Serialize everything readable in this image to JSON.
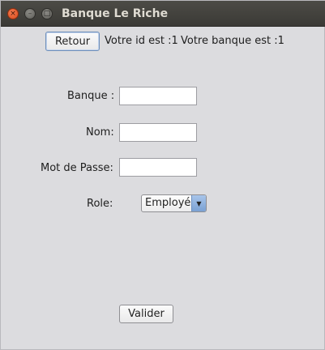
{
  "window": {
    "title": "Banque Le Riche",
    "controls": {
      "close_glyph": "×",
      "minimize_glyph": "–",
      "maximize_glyph": "□"
    }
  },
  "header": {
    "back_label": "Retour",
    "id_text": "Votre id est :1",
    "bank_text": "Votre banque est :1"
  },
  "form": {
    "bank_label": "Banque :",
    "bank_value": "",
    "name_label": "Nom:",
    "name_value": "",
    "password_label": "Mot de Passe:",
    "password_value": "",
    "role_label": "Role:",
    "role_selected": "Employé",
    "role_arrow_glyph": "▼",
    "submit_label": "Valider"
  },
  "colors": {
    "titlebar": "#3b3a36",
    "window_bg": "#dcdcdf",
    "close_button": "#e25b2d",
    "accent": "#7aa1d3"
  }
}
